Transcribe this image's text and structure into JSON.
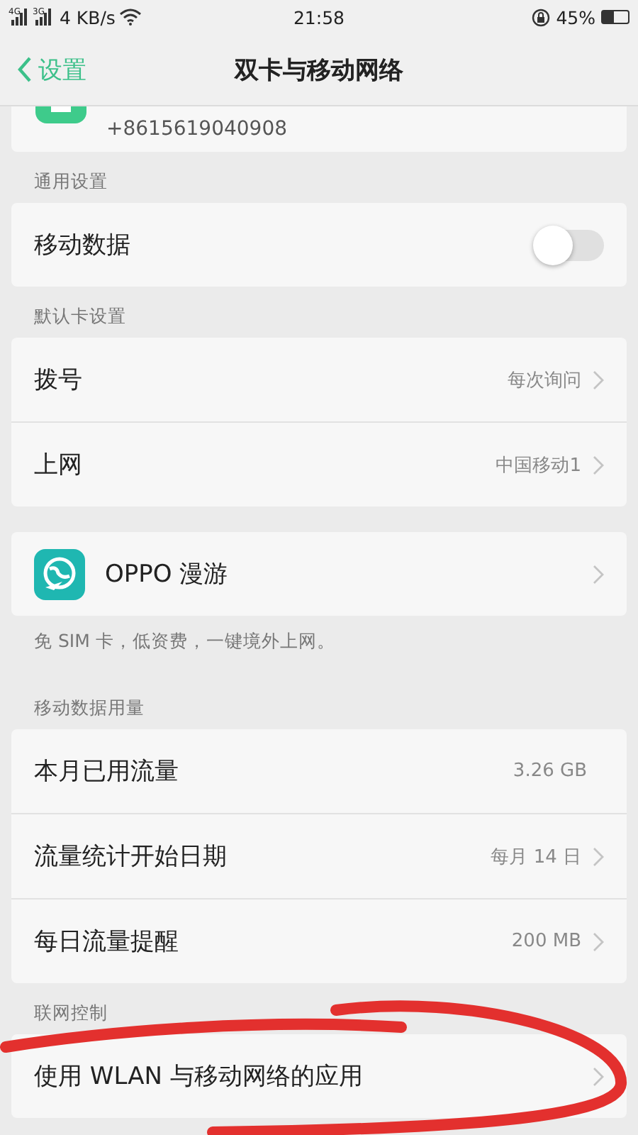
{
  "status_bar": {
    "signals": [
      "4G",
      "3G"
    ],
    "speed": "4 KB/s",
    "time": "21:58",
    "battery": "45%"
  },
  "header": {
    "back": "设置",
    "title": "双卡与移动网络"
  },
  "sim_card": {
    "number": "+8615619040908"
  },
  "sections": [
    {
      "title": "通用设置",
      "rows": [
        {
          "kind": "toggle",
          "label": "移动数据",
          "on": false
        }
      ]
    },
    {
      "title": "默认卡设置",
      "rows": [
        {
          "kind": "value",
          "label": "拨号",
          "value": "每次询问"
        },
        {
          "kind": "value",
          "label": "上网",
          "value": "中国移动1"
        }
      ]
    },
    {
      "rows": [
        {
          "kind": "app",
          "label": "OPPO 漫游"
        }
      ],
      "note": "免 SIM 卡，低资费，一键境外上网。"
    },
    {
      "title": "移动数据用量",
      "rows": [
        {
          "kind": "info",
          "label": "本月已用流量",
          "value": "3.26 GB"
        },
        {
          "kind": "value",
          "label": "流量统计开始日期",
          "value": "每月 14 日"
        },
        {
          "kind": "value",
          "label": "每日流量提醒",
          "value": "200 MB"
        }
      ]
    },
    {
      "title": "联网控制",
      "rows": [
        {
          "kind": "link",
          "label": "使用 WLAN 与移动网络的应用"
        }
      ]
    }
  ]
}
